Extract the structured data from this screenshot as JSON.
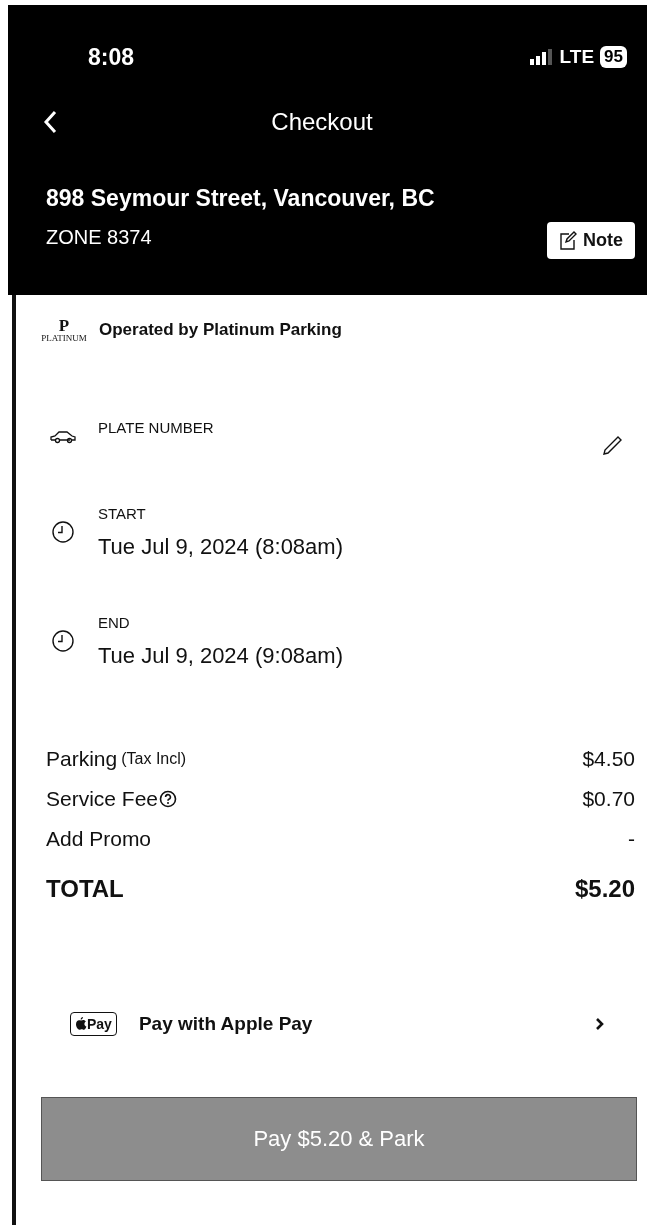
{
  "status_bar": {
    "time": "8:08",
    "network": "LTE",
    "battery": "95"
  },
  "header": {
    "title": "Checkout",
    "address": "898 Seymour Street, Vancouver, BC",
    "zone": "ZONE 8374",
    "note_button": "Note"
  },
  "operator": {
    "logo_letter": "P",
    "logo_caption": "PLATINUM",
    "text": "Operated by Platinum Parking"
  },
  "details": [
    {
      "kind": "plate",
      "label": "PLATE NUMBER"
    },
    {
      "kind": "time",
      "label": "START",
      "value": "Tue Jul 9, 2024 (8:08am)"
    },
    {
      "kind": "time",
      "label": "END",
      "value": "Tue Jul 9, 2024 (9:08am)"
    }
  ],
  "charges": [
    {
      "kind": "line",
      "label": "Parking",
      "note": "(Tax Incl)",
      "amount": "$4.50"
    },
    {
      "kind": "help",
      "label": "Service Fee",
      "amount": "$0.70"
    },
    {
      "kind": "line",
      "label": "Add Promo",
      "amount": "-"
    },
    {
      "kind": "total",
      "label": "TOTAL",
      "amount": "$5.20"
    }
  ],
  "payment": {
    "mark_text": "Pay",
    "label": "Pay with Apple Pay"
  },
  "pay_button": {
    "label": "Pay $5.20 & Park",
    "disabled": true
  }
}
